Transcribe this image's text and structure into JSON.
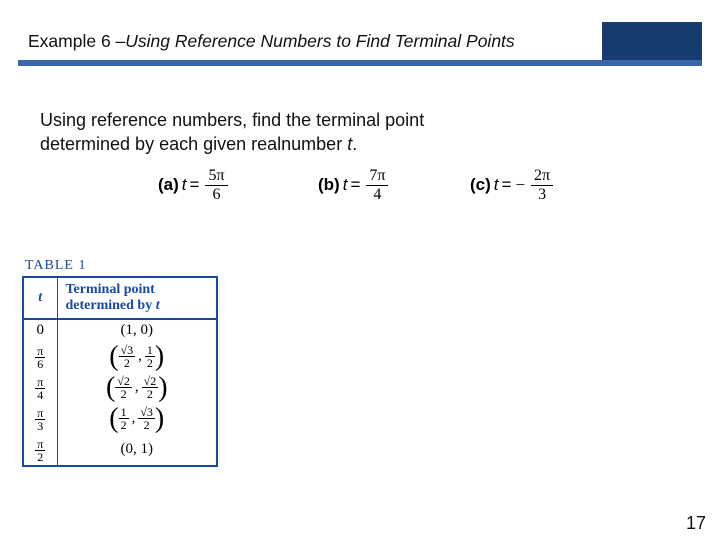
{
  "header": {
    "prefix": "Example 6 – ",
    "title_italic": "Using Reference Numbers to Find Terminal Points"
  },
  "intro": {
    "line1": "Using reference numbers, find the terminal point",
    "line2_a": "determined by each given real",
    "line2_b": "number ",
    "var": "t",
    "line2_c": "."
  },
  "items": {
    "a": {
      "label": "(a)",
      "var": "t",
      "eq": " =",
      "num": "5π",
      "den": "6"
    },
    "b": {
      "label": "(b)",
      "var": "t",
      "eq": " =",
      "num": "7π",
      "den": "4"
    },
    "c": {
      "label": "(c)",
      "var": "t",
      "eq": " =",
      "neg": "−",
      "num": "2π",
      "den": "3"
    }
  },
  "table": {
    "title": "TABLE 1",
    "head_t": "t",
    "head_tp1": "Terminal point",
    "head_tp2": "determined by ",
    "head_tp_var": "t",
    "rows": [
      {
        "t_num": "0",
        "t_den": "",
        "pair_txt": "(1, 0)"
      },
      {
        "t_num": "π",
        "t_den": "6",
        "x_num": "√3",
        "x_den": "2",
        "y_num": "1",
        "y_den": "2"
      },
      {
        "t_num": "π",
        "t_den": "4",
        "x_num": "√2",
        "x_den": "2",
        "y_num": "√2",
        "y_den": "2"
      },
      {
        "t_num": "π",
        "t_den": "3",
        "x_num": "1",
        "x_den": "2",
        "y_num": "√3",
        "y_den": "2"
      },
      {
        "t_num": "π",
        "t_den": "2",
        "pair_txt": "(0, 1)"
      }
    ]
  },
  "page_number": "17",
  "chart_data": {
    "type": "table",
    "title": "TABLE 1 — Terminal point determined by t",
    "columns": [
      "t",
      "Terminal point determined by t"
    ],
    "rows": [
      [
        "0",
        "(1, 0)"
      ],
      [
        "π/6",
        "(√3/2, 1/2)"
      ],
      [
        "π/4",
        "(√2/2, √2/2)"
      ],
      [
        "π/3",
        "(1/2, √3/2)"
      ],
      [
        "π/2",
        "(0, 1)"
      ]
    ]
  }
}
